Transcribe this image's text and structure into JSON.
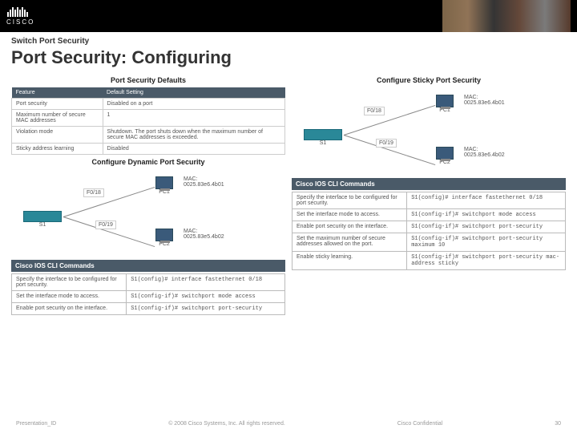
{
  "header": {
    "logo_text": "CISCO"
  },
  "breadcrumb": "Switch Port Security",
  "title": "Port Security: Configuring",
  "defaults": {
    "title": "Port Security Defaults",
    "cols": {
      "c1": "Feature",
      "c2": "Default Setting"
    },
    "rows": [
      {
        "f": "Port security",
        "d": "Disabled on a port"
      },
      {
        "f": "Maximum number of secure MAC addresses",
        "d": "1"
      },
      {
        "f": "Violation mode",
        "d": "Shutdown. The port shuts down when the maximum number of secure MAC addresses is exceeded."
      },
      {
        "f": "Sticky address learning",
        "d": "Disabled"
      }
    ]
  },
  "dynamic": {
    "title": "Configure Dynamic Port Security",
    "topo": {
      "s1": "S1",
      "pc1": "PC1",
      "pc2": "PC2",
      "mac1": "MAC:\n0025.83e6.4b01",
      "mac2": "MAC:\n0025.83e5.4b02",
      "port1": "F0/18",
      "port2": "F0/19"
    },
    "cli_title": "Cisco IOS CLI Commands",
    "cli": [
      {
        "d": "Specify the interface to be configured for port security.",
        "c": "S1(config)# interface fastethernet 0/18"
      },
      {
        "d": "Set the interface mode to access.",
        "c": "S1(config-if)# switchport mode access"
      },
      {
        "d": "Enable port security on the interface.",
        "c": "S1(config-if)# switchport port-security"
      }
    ]
  },
  "sticky": {
    "title": "Configure Sticky Port Security",
    "topo": {
      "s1": "S1",
      "pc1": "PC1",
      "pc2": "PC2",
      "mac1": "MAC:\n0025.83e6.4b01",
      "mac2": "MAC:\n0025.83e6.4b02",
      "port1": "F0/18",
      "port2": "F0/19"
    },
    "cli_title": "Cisco IOS CLI Commands",
    "cli": [
      {
        "d": "Specify the interface to be configured for port security.",
        "c": "S1(config)# interface fastethernet 0/18"
      },
      {
        "d": "Set the interface mode to access.",
        "c": "S1(config-if)# switchport mode access"
      },
      {
        "d": "Enable port security on the interface.",
        "c": "S1(config-if)# switchport port-security"
      },
      {
        "d": "Set the maximum number of secure addresses allowed on the port.",
        "c": "S1(config-if)# switchport port-security maximum 10"
      },
      {
        "d": "Enable sticky learning.",
        "c": "S1(config-if)# switchport port-security mac-address sticky"
      }
    ]
  },
  "footer": {
    "left": "Presentation_ID",
    "mid": "© 2008 Cisco Systems, Inc. All rights reserved.",
    "right": "Cisco Confidential",
    "pg": "30"
  }
}
